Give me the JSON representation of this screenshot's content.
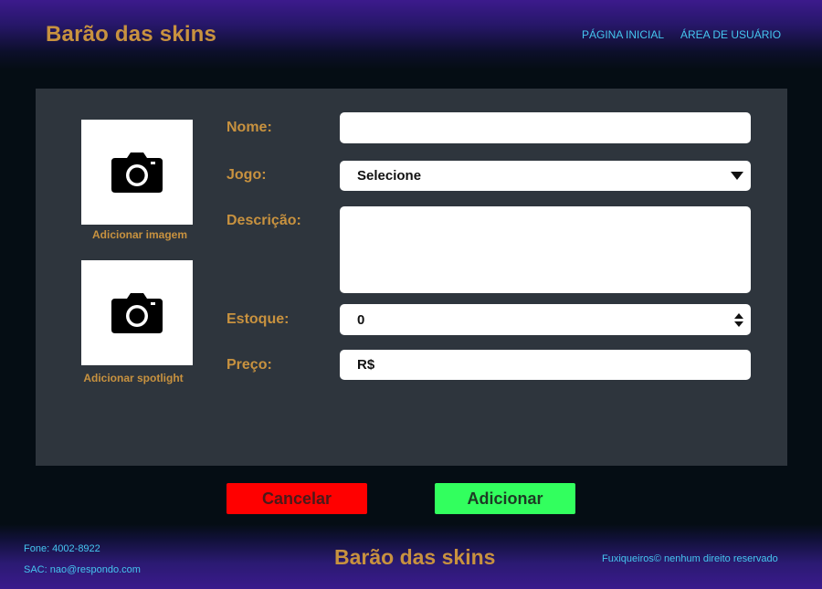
{
  "header": {
    "brand": "Barão das skins",
    "nav": [
      {
        "label": "PÁGINA INICIAL"
      },
      {
        "label": "ÁREA DE USUÁRIO"
      }
    ]
  },
  "form": {
    "image_upload": {
      "caption": "Adicionar imagem",
      "icon": "camera-icon"
    },
    "spotlight_upload": {
      "caption": "Adicionar spotlight",
      "icon": "camera-icon"
    },
    "fields": {
      "nome": {
        "label": "Nome:",
        "value": ""
      },
      "jogo": {
        "label": "Jogo:",
        "value": "Selecione"
      },
      "descricao": {
        "label": "Descrição:",
        "value": ""
      },
      "estoque": {
        "label": "Estoque:",
        "value": "0"
      },
      "preco": {
        "label": "Preço:",
        "value": "R$"
      }
    },
    "buttons": {
      "cancel": "Cancelar",
      "add": "Adicionar"
    }
  },
  "footer": {
    "phone": "Fone: 4002-8922",
    "sac": "SAC: nao@respondo.com",
    "brand": "Barão das skins",
    "copyright": "Fuxiqueiros© nenhum direito reservado"
  },
  "colors": {
    "accent": "#c8923f",
    "link": "#45c6ef",
    "cancel": "#ff0000",
    "add": "#32ff5e",
    "panel": "#2e353d"
  }
}
